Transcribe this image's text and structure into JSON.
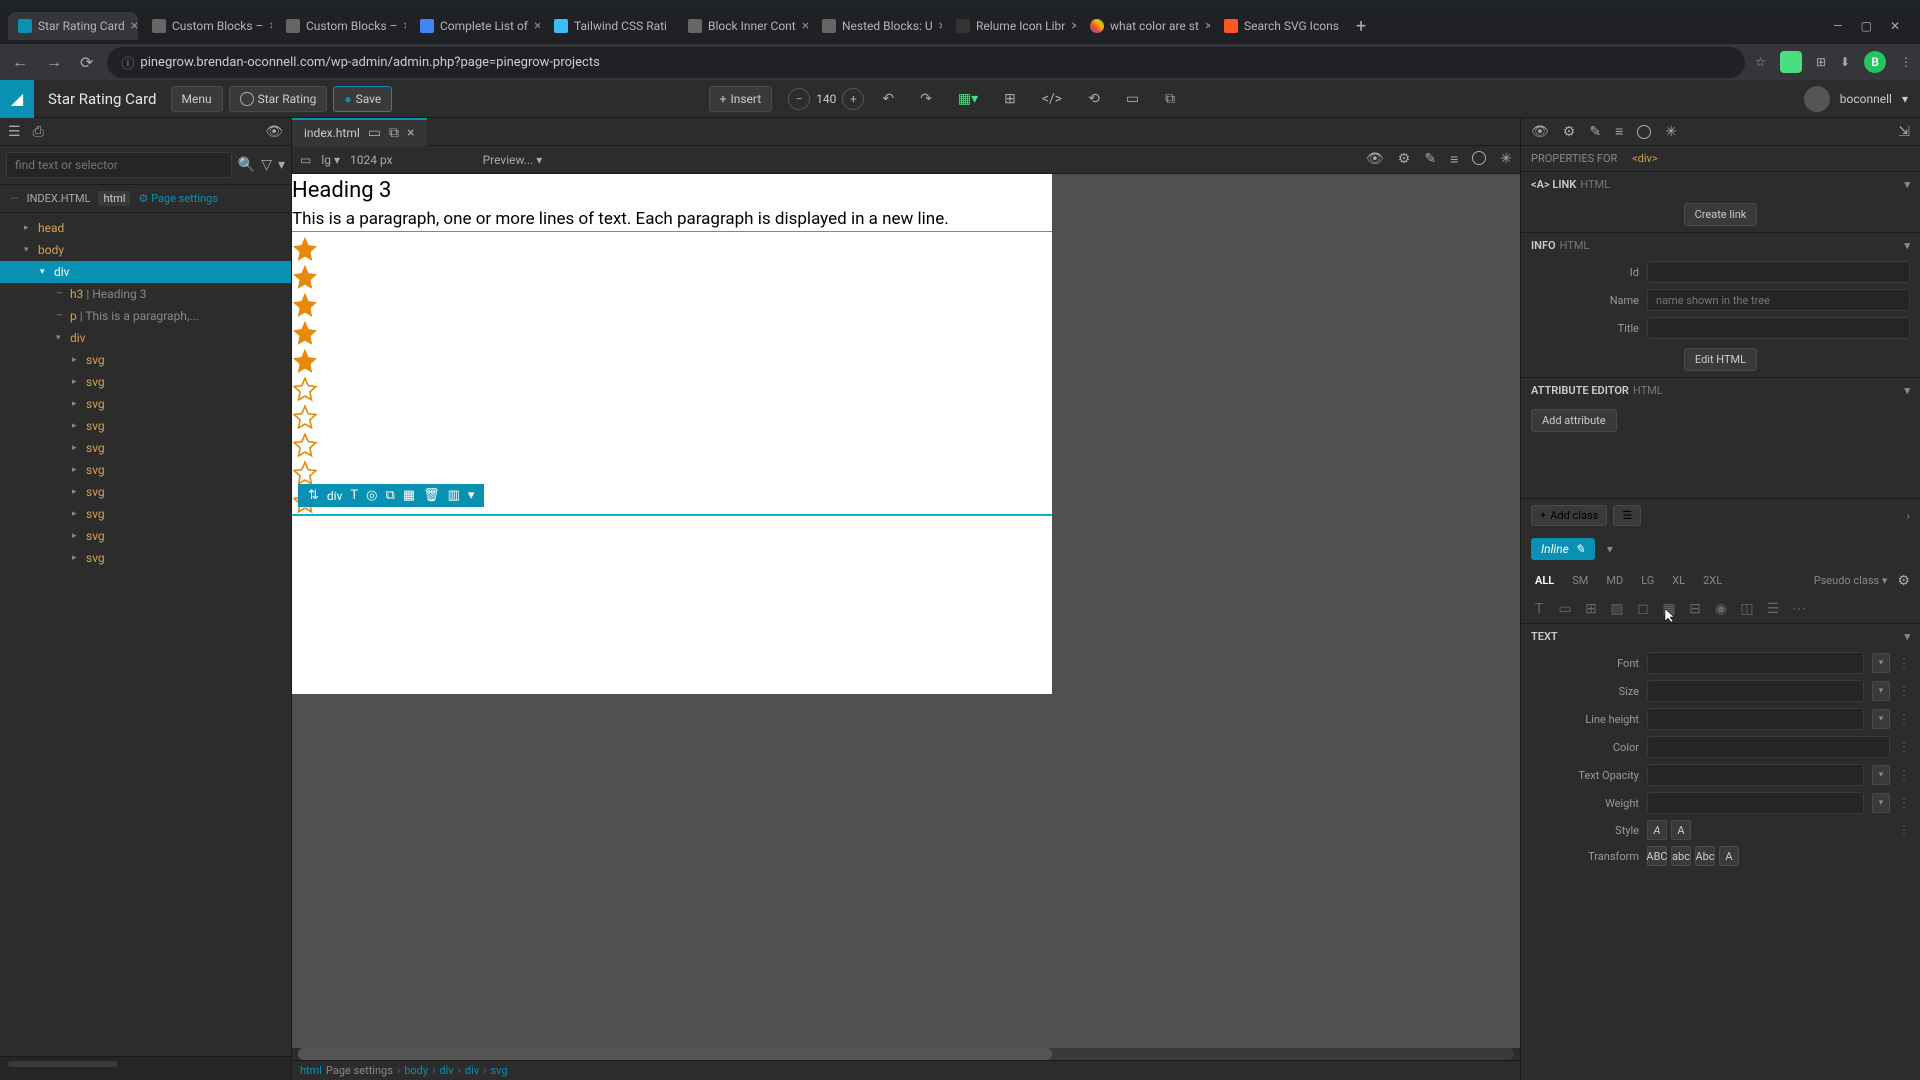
{
  "browser": {
    "tabs": [
      {
        "label": "Star Rating Card"
      },
      {
        "label": "Custom Blocks –"
      },
      {
        "label": "Custom Blocks –"
      },
      {
        "label": "Complete List of"
      },
      {
        "label": "Tailwind CSS Rati"
      },
      {
        "label": "Block Inner Cont"
      },
      {
        "label": "Nested Blocks: U"
      },
      {
        "label": "Relume Icon Libr"
      },
      {
        "label": "what color are st"
      },
      {
        "label": "Search SVG Icons"
      }
    ],
    "url": "pinegrow.brendan-oconnell.com/wp-admin/admin.php?page=pinegrow-projects"
  },
  "header": {
    "project": "Star Rating Card",
    "menu": "Menu",
    "component": "Star Rating",
    "save": "Save",
    "insert": "Insert",
    "zoom": "140",
    "user": "boconnell"
  },
  "left": {
    "search_placeholder": "find text or selector",
    "file": "INDEX.HTML",
    "file_ext": "html",
    "page_settings": "Page settings",
    "tree": [
      {
        "indent": 1,
        "tag": "head",
        "arrow": "▸"
      },
      {
        "indent": 1,
        "tag": "body",
        "arrow": "▾"
      },
      {
        "indent": 2,
        "tag": "div",
        "arrow": "▾",
        "selected": true
      },
      {
        "indent": 3,
        "tag": "h3",
        "text": " | Heading 3",
        "leaf": true
      },
      {
        "indent": 3,
        "tag": "p",
        "text": " | This is a paragraph,...",
        "leaf": true
      },
      {
        "indent": 3,
        "tag": "div",
        "arrow": "▾"
      },
      {
        "indent": 4,
        "tag": "svg",
        "arrow": "▸"
      },
      {
        "indent": 4,
        "tag": "svg",
        "arrow": "▸"
      },
      {
        "indent": 4,
        "tag": "svg",
        "arrow": "▸"
      },
      {
        "indent": 4,
        "tag": "svg",
        "arrow": "▸"
      },
      {
        "indent": 4,
        "tag": "svg",
        "arrow": "▸"
      },
      {
        "indent": 4,
        "tag": "svg",
        "arrow": "▸"
      },
      {
        "indent": 4,
        "tag": "svg",
        "arrow": "▸"
      },
      {
        "indent": 4,
        "tag": "svg",
        "arrow": "▸"
      },
      {
        "indent": 4,
        "tag": "svg",
        "arrow": "▸"
      },
      {
        "indent": 4,
        "tag": "svg",
        "arrow": "▸"
      }
    ]
  },
  "center": {
    "file_tab": "index.html",
    "breakpoint": "lg",
    "width": "1024 px",
    "preview": "Preview...",
    "heading": "Heading 3",
    "paragraph": "This is a paragraph, one or more lines of text. Each paragraph is displayed in a new line.",
    "stars_filled": 5,
    "stars_empty": 5,
    "sel_tag": "div",
    "breadcrumb": [
      "html",
      "Page settings",
      "body",
      "div",
      "div",
      "svg"
    ]
  },
  "right": {
    "props_for": "PROPERTIES FOR",
    "props_tag": "<div>",
    "link_section": "<A> LINK",
    "link_sub": "HTML",
    "create_link": "Create link",
    "info_section": "INFO",
    "info_sub": "HTML",
    "id_label": "Id",
    "name_label": "Name",
    "name_placeholder": "name shown in the tree",
    "title_label": "Title",
    "edit_html": "Edit HTML",
    "attr_section": "ATTRIBUTE EDITOR",
    "attr_sub": "HTML",
    "add_attr": "Add attribute",
    "add_class": "Add class",
    "inline": "Inline",
    "breakpoints": [
      "ALL",
      "SM",
      "MD",
      "LG",
      "XL",
      "2XL"
    ],
    "pseudo": "Pseudo class",
    "text_section": "TEXT",
    "font_label": "Font",
    "size_label": "Size",
    "lh_label": "Line height",
    "color_label": "Color",
    "opacity_label": "Text Opacity",
    "weight_label": "Weight",
    "style_label": "Style",
    "transform_label": "Transform",
    "transform_vals": [
      "ABC",
      "abc",
      "Abc",
      "A"
    ]
  }
}
